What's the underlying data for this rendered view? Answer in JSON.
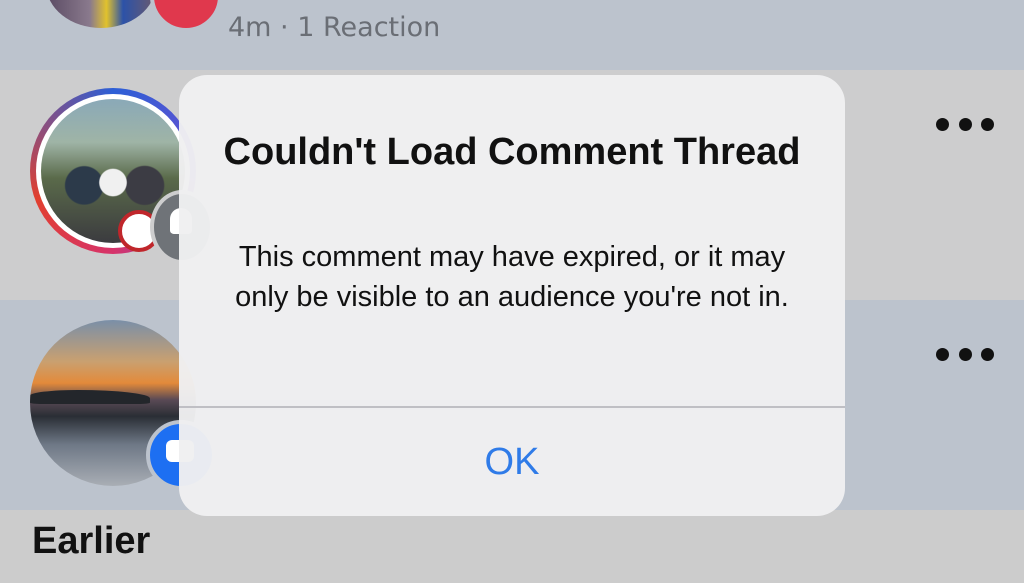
{
  "notifications": [
    {
      "meta": "4m · 1 Reaction",
      "badge_icon": "heart-icon"
    },
    {
      "badge_icon": "bell-icon"
    },
    {
      "badge_icon": "comment-icon"
    }
  ],
  "section": {
    "title": "Earlier"
  },
  "alert": {
    "title": "Couldn't Load Comment Thread",
    "message": "This comment may have expired, or it may only be visible to an audience you're not in.",
    "ok_label": "OK"
  },
  "colors": {
    "accent": "#2f7be8",
    "reaction_badge": "#e0384d",
    "comment_badge": "#1d6ff2"
  }
}
